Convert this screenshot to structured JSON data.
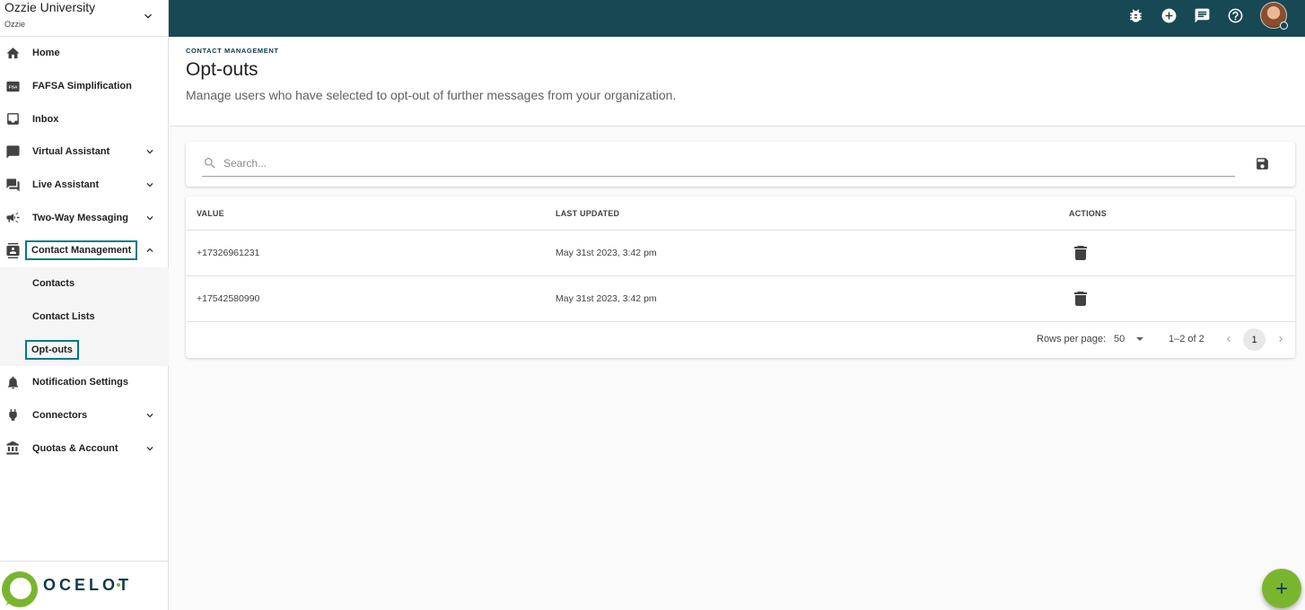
{
  "org": {
    "name": "Ozzie University",
    "short": "Ozzie"
  },
  "sidebar": {
    "items": [
      {
        "label": "Home",
        "icon": "home-icon"
      },
      {
        "label": "FAFSA Simplification",
        "icon": "fsa-icon"
      },
      {
        "label": "Inbox",
        "icon": "inbox-icon"
      },
      {
        "label": "Virtual Assistant",
        "icon": "chat-bubble-icon",
        "expandable": true
      },
      {
        "label": "Live Assistant",
        "icon": "forum-icon",
        "expandable": true
      },
      {
        "label": "Two-Way Messaging",
        "icon": "campaign-icon",
        "expandable": true
      },
      {
        "label": "Contact Management",
        "icon": "contacts-icon",
        "expandable": true,
        "expanded": true
      },
      {
        "label": "Notification Settings",
        "icon": "bell-icon"
      },
      {
        "label": "Connectors",
        "icon": "plug-icon",
        "expandable": true
      },
      {
        "label": "Quotas & Account",
        "icon": "bank-icon",
        "expandable": true
      }
    ],
    "contact_sub": [
      "Contacts",
      "Contact Lists",
      "Opt-outs"
    ]
  },
  "brand": {
    "logo_text": "OCELOT",
    "accent": "#7ab530",
    "topbar_color": "#174854",
    "highlight": "#007b83"
  },
  "header": {
    "breadcrumb": "CONTACT MANAGEMENT",
    "title": "Opt-outs",
    "description": "Manage users who have selected to opt-out of further messages from your organization."
  },
  "search": {
    "placeholder": "Search..."
  },
  "table": {
    "columns": [
      "VALUE",
      "LAST UPDATED",
      "ACTIONS"
    ],
    "rows": [
      {
        "value": "+17326961231",
        "updated": "May 31st 2023, 3:42 pm"
      },
      {
        "value": "+17542580990",
        "updated": "May 31st 2023, 3:42 pm"
      }
    ]
  },
  "pagination": {
    "rows_label": "Rows per page:",
    "rows_value": "50",
    "range": "1–2 of 2",
    "current": "1"
  }
}
